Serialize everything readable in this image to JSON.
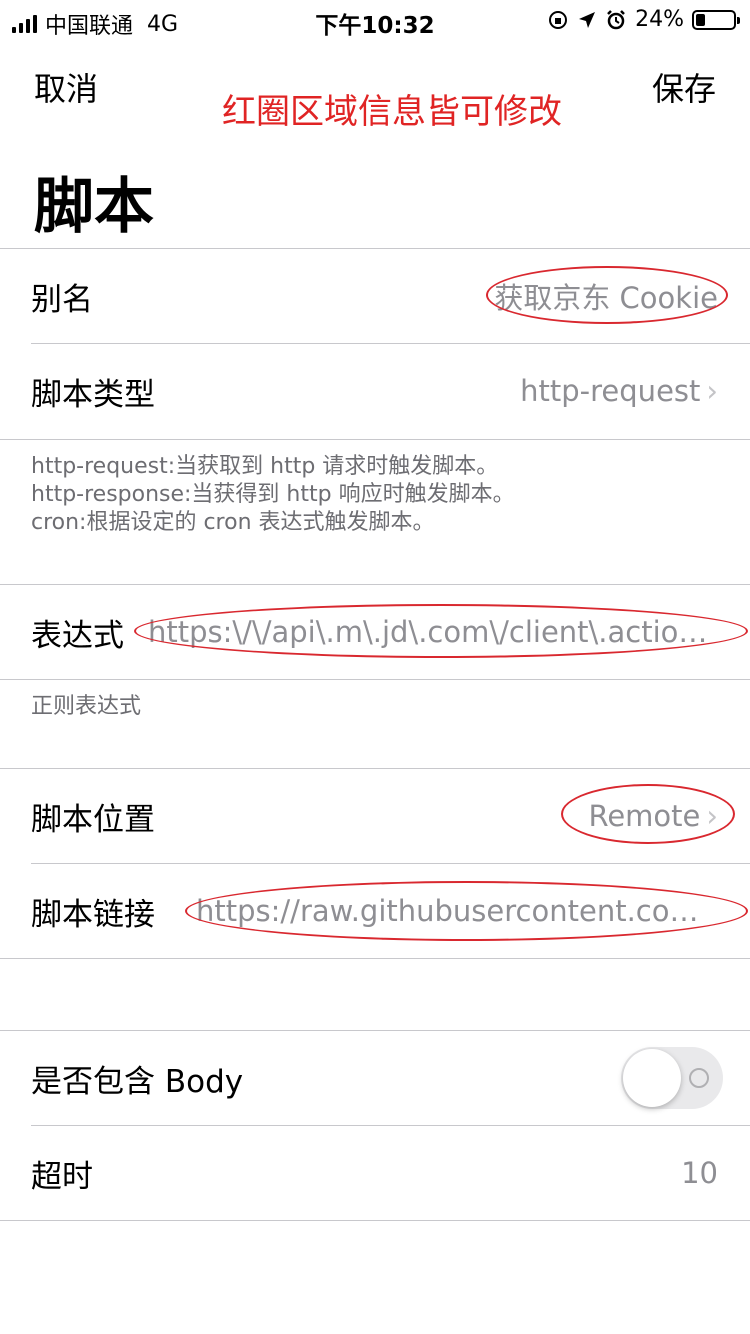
{
  "status_bar": {
    "carrier": "中国联通",
    "network": "4G",
    "time": "下午10:32",
    "battery_text": "24%",
    "battery_level": 0.24
  },
  "nav": {
    "cancel": "取消",
    "save": "保存",
    "annotation": "红圈区域信息皆可修改"
  },
  "page_title": "脚本",
  "fields": {
    "alias": {
      "label": "别名",
      "value": "获取京东 Cookie"
    },
    "script_type": {
      "label": "脚本类型",
      "value": "http-request"
    },
    "type_help": [
      "http-request:当获取到 http 请求时触发脚本。",
      "http-response:当获得到 http 响应时触发脚本。",
      "cron:根据设定的 cron 表达式触发脚本。"
    ],
    "expression": {
      "label": "表达式",
      "value": "https:\\/\\/api\\.m\\.jd\\.com\\/client\\.action.*f..."
    },
    "expression_help": "正则表达式",
    "script_location": {
      "label": "脚本位置",
      "value": "Remote"
    },
    "script_link": {
      "label": "脚本链接",
      "value": "https://raw.githubusercontent.com/N..."
    },
    "include_body": {
      "label": "是否包含 Body",
      "enabled": false
    },
    "timeout": {
      "label": "超时",
      "value": "10"
    }
  }
}
